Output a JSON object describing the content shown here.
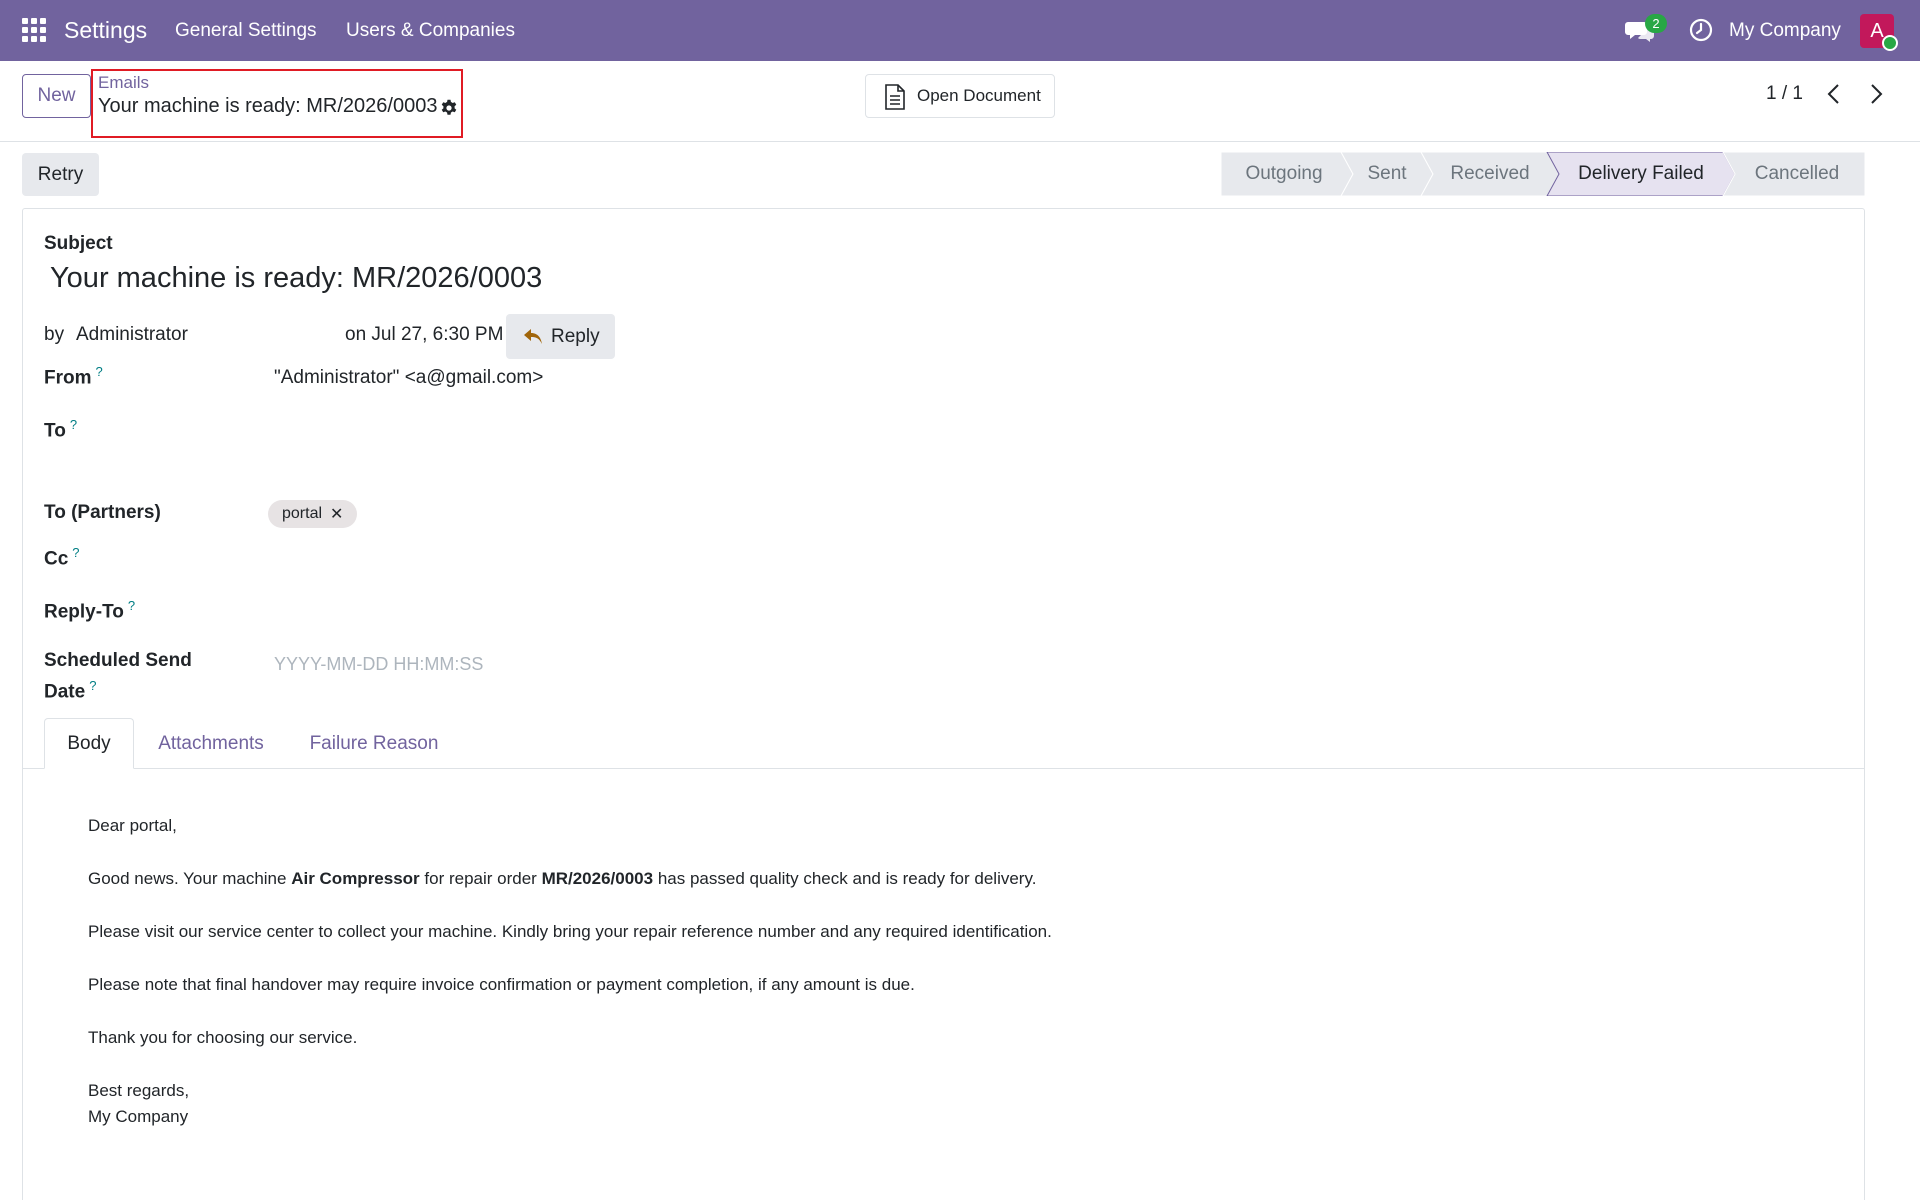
{
  "navbar": {
    "app_name": "Settings",
    "menu": [
      "General Settings",
      "Users & Companies"
    ],
    "messages_count": "2",
    "company": "My Company",
    "avatar_letter": "A",
    "colors": {
      "bar": "#71639e",
      "avatar": "#c2185b",
      "badge": "#28a745"
    }
  },
  "control_panel": {
    "new_label": "New",
    "breadcrumb_parent": "Emails",
    "breadcrumb_current": "Your machine is ready: MR/2026/0003",
    "open_document_label": "Open Document",
    "pager": "1 / 1"
  },
  "actions": {
    "retry_label": "Retry"
  },
  "statusbar": {
    "stages": [
      "Outgoing",
      "Sent",
      "Received",
      "Delivery Failed",
      "Cancelled"
    ],
    "active": "Delivery Failed"
  },
  "form": {
    "subject_label": "Subject",
    "subject": "Your machine is ready: MR/2026/0003",
    "by_label": "by",
    "author": "Administrator",
    "date": "on Jul 27, 6:30 PM",
    "reply_label": "Reply",
    "help_mark": "?",
    "from_label": "From",
    "from_value": "\"Administrator\" <a@gmail.com>",
    "to_label": "To",
    "to_partners_label": "To (Partners)",
    "partner_tag": "portal",
    "tag_remove": "✕",
    "cc_label": "Cc",
    "reply_to_label": "Reply-To",
    "scheduled_label_line1": "Scheduled Send",
    "scheduled_label_line2": "Date",
    "scheduled_placeholder": "YYYY-MM-DD HH:MM:SS"
  },
  "tabs": [
    "Body",
    "Attachments",
    "Failure Reason"
  ],
  "body": {
    "greeting": "Dear portal,",
    "line1_a": "Good news. Your machine ",
    "machine": "Air Compressor",
    "line1_b": " for repair order ",
    "order": "MR/2026/0003",
    "line1_c": " has passed quality check and is ready for delivery.",
    "line2": "Please visit our service center to collect your machine. Kindly bring your repair reference number and any required identification.",
    "line3": "Please note that final handover may require invoice confirmation or payment completion, if any amount is due.",
    "line4": "Thank you for choosing our service.",
    "closing": "Best regards,",
    "signature": "My Company"
  }
}
